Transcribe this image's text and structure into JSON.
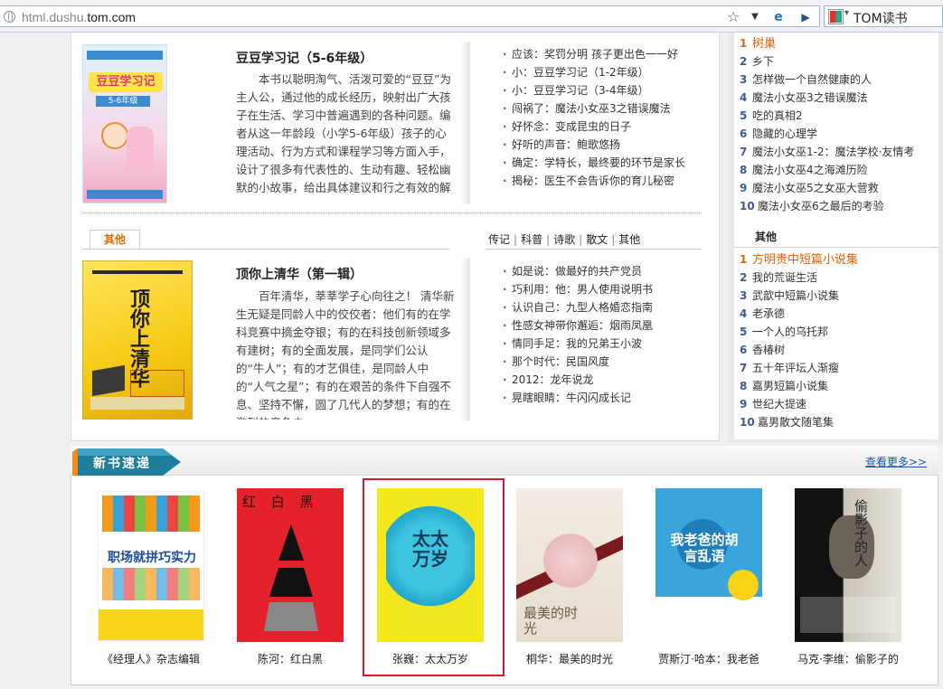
{
  "browser": {
    "address_prefix": "html.dushu.",
    "address_domain": "tom.com",
    "search_engine_label": "TOM读书",
    "icons": [
      "globe-icon",
      "favorite-star-icon",
      "dropdown-arrow-icon",
      "ie-compat-icon",
      "forward-icon",
      "search-engine-logo-icon"
    ]
  },
  "featured": [
    {
      "title": "豆豆学习记（5-6年级）",
      "description": "本书以聪明淘气、活泼可爱的“豆豆”为主人公，通过他的成长经历，映射出广大孩子在生活、学习中普遍遇到的各种问题。编者从这一年龄段（小学5-6年级）孩子的心理活动、行为方式和课程学习等方面入手，设计了很多有代表性的、生动有趣、轻松幽默的小故事，给出具体建议和行之有效的解决方案，帮",
      "cover_text": "豆豆学习记",
      "cover_sub": "5-6年级",
      "links": [
        "应该：奖罚分明 孩子更出色一一好",
        "小：豆豆学习记（1-2年级）",
        "小：豆豆学习记（3-4年级）",
        "闯祸了：魔法小女巫3之错误魔法",
        "好怀念：变成昆虫的日子",
        "好听的声音：鲍歌悠扬",
        "确定：学特长，最终要的环节是家长",
        "揭秘：医生不会告诉你的育儿秘密"
      ]
    },
    {
      "title": "顶你上清华（第一辑）",
      "description": "百年清华，莘莘学子心向往之！ 清华新生无疑是同龄人中的佼佼者：他们有的在学科竞赛中摘金夺银；有的在科技创新领域多有建树；有的全面发展，是同学们公认的“牛人”；有的才艺俱佳，是同龄人中的“人气之星”；有的在艰苦的条件下自强不息、坚持不懈，圆了几代人的梦想；有的在激烈的竞争中",
      "cover_text": "顶你上清华",
      "links": [
        "如是说：做最好的共产党员",
        "巧利用：他：男人使用说明书",
        "认识自己：九型人格婚恋指南",
        "性感女神带你邂逅：烟雨凤凰",
        "情同手足：我的兄弟王小波",
        "那个时代：民国风度",
        "2012：龙年说龙",
        "晃瞎眼睛：牛闪闪成长记"
      ]
    }
  ],
  "tab_other": "其他",
  "categories": [
    "传记",
    "科普",
    "诗歌",
    "散文",
    "其他"
  ],
  "category_separator": "|",
  "ranking_top": [
    {
      "n": "1",
      "t": "树巢"
    },
    {
      "n": "2",
      "t": "乡下"
    },
    {
      "n": "3",
      "t": "怎样做一个自然健康的人"
    },
    {
      "n": "4",
      "t": "魔法小女巫3之错误魔法"
    },
    {
      "n": "5",
      "t": "吃的真相2"
    },
    {
      "n": "6",
      "t": "隐藏的心理学"
    },
    {
      "n": "7",
      "t": "魔法小女巫1-2：魔法学校·友情考"
    },
    {
      "n": "8",
      "t": "魔法小女巫4之海滩历险"
    },
    {
      "n": "9",
      "t": "魔法小女巫5之女巫大营救"
    },
    {
      "n": "10",
      "t": "魔法小女巫6之最后的考验"
    }
  ],
  "ranking_other_header": "其他",
  "ranking_other": [
    {
      "n": "1",
      "t": "方明贵中短篇小说集"
    },
    {
      "n": "2",
      "t": "我的荒诞生活"
    },
    {
      "n": "3",
      "t": "武歆中短篇小说集"
    },
    {
      "n": "4",
      "t": "老承德"
    },
    {
      "n": "5",
      "t": "一个人的乌托邦"
    },
    {
      "n": "6",
      "t": "香椿树"
    },
    {
      "n": "7",
      "t": "五十年评坛人渐瘦"
    },
    {
      "n": "8",
      "t": "嘉男短篇小说集"
    },
    {
      "n": "9",
      "t": "世纪大提速"
    },
    {
      "n": "10",
      "t": "嘉男散文随笔集"
    }
  ],
  "new_books": {
    "title": "新书速递",
    "more": "查看更多>>",
    "items": [
      {
        "caption": "《经理人》杂志编辑",
        "cover_text": "职场就拼巧实力"
      },
      {
        "caption": "陈河：红白黑",
        "cover_text": "红 白 黑"
      },
      {
        "caption": "张巍：太太万岁",
        "cover_text": "太太万岁"
      },
      {
        "caption": "桐华：最美的时光",
        "cover_text": "最美的时光"
      },
      {
        "caption": "贾斯汀·哈本：我老爸",
        "cover_text": "我老爸的胡言乱语"
      },
      {
        "caption": "马克·李维：偷影子的",
        "cover_text": "偷影子的人"
      }
    ]
  },
  "colors": {
    "accent_orange": "#e0620a",
    "link_blue": "#1a56a8",
    "highlight_red": "#d7192a",
    "tab_teal": "#1f7e9b"
  }
}
